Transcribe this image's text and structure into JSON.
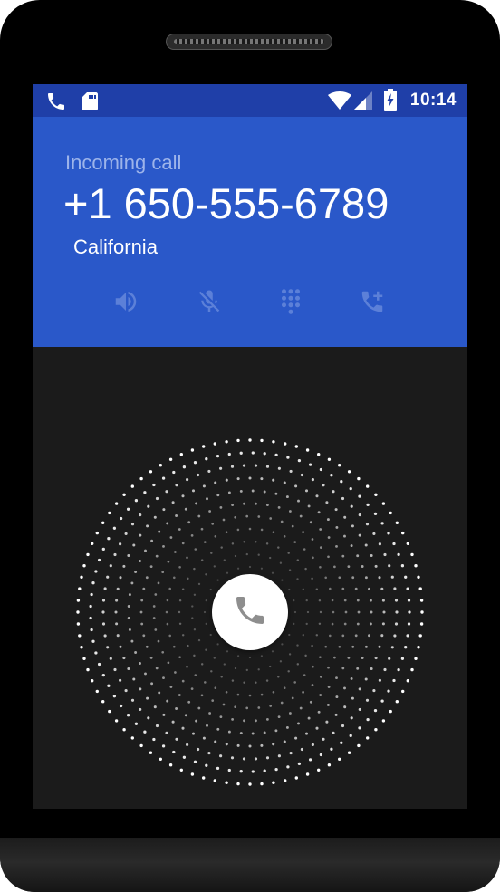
{
  "status_bar": {
    "time": "10:14",
    "left_icons": [
      "phone-call-icon",
      "sd-card-icon"
    ],
    "right_icons": [
      "wifi-icon",
      "cell-signal-icon",
      "battery-charging-icon"
    ]
  },
  "call": {
    "label": "Incoming call",
    "number": "+1 650-555-6789",
    "location": "California",
    "actions": [
      {
        "icon": "speaker-icon"
      },
      {
        "icon": "mute-mic-icon"
      },
      {
        "icon": "dialpad-icon"
      },
      {
        "icon": "add-call-icon"
      }
    ]
  },
  "answer": {
    "icon": "phone-answer-icon"
  },
  "colors": {
    "status_bar_bg": "#1f3fa8",
    "header_bg": "#2a58c9",
    "screen_bg": "#1b1b1b",
    "action_icon": "#5c80d8"
  }
}
